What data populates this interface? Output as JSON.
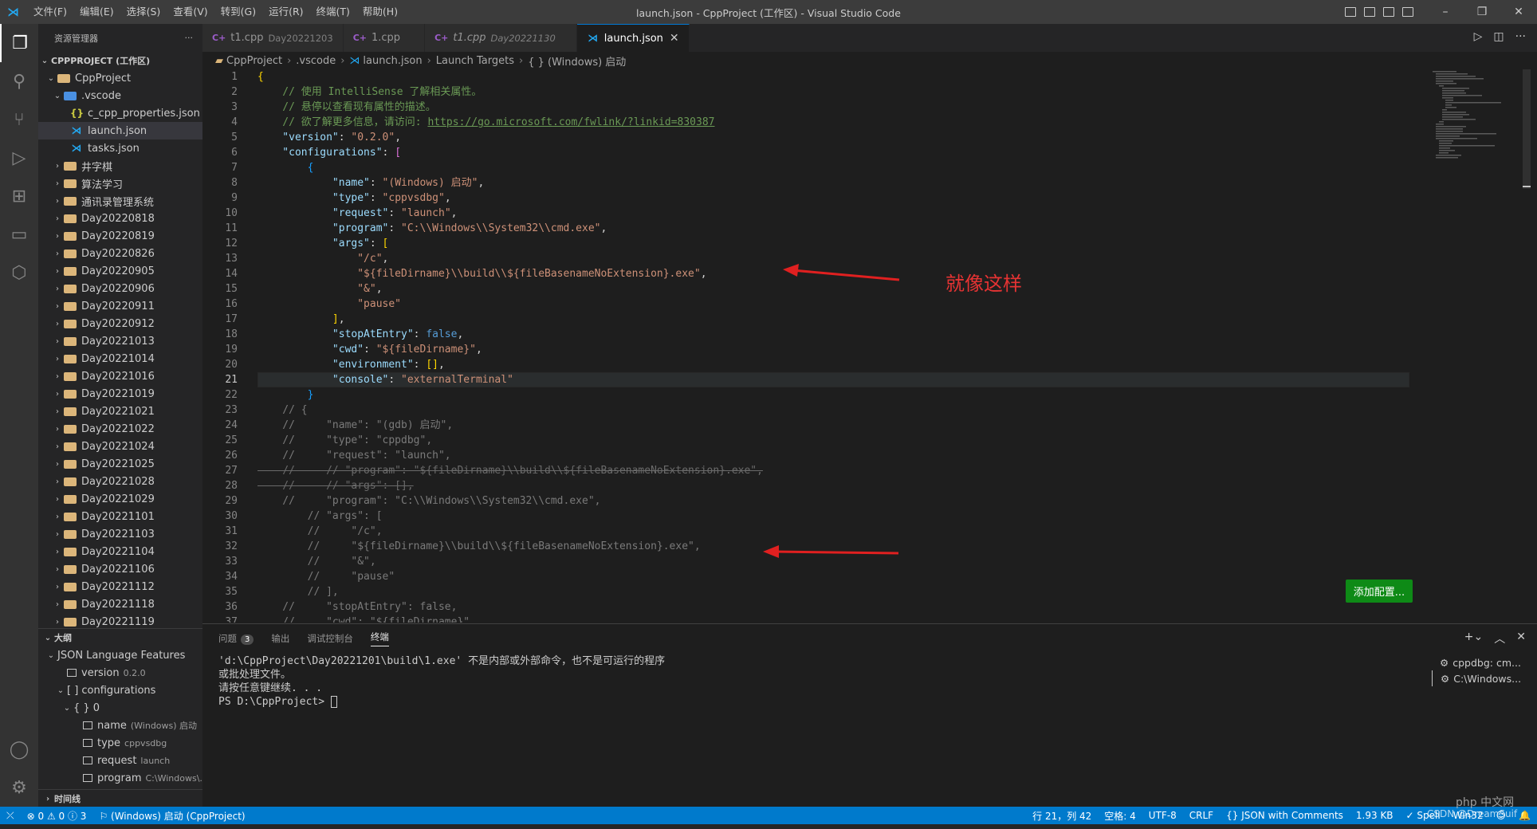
{
  "window_title": "launch.json - CppProject (工作区) - Visual Studio Code",
  "menu": [
    "文件(F)",
    "编辑(E)",
    "选择(S)",
    "查看(V)",
    "转到(G)",
    "运行(R)",
    "终端(T)",
    "帮助(H)"
  ],
  "sidebar": {
    "title": "资源管理器",
    "workspace": "CPPPROJECT (工作区)",
    "project": "CppProject",
    "vscode": ".vscode",
    "vscode_files": [
      "c_cpp_properties.json",
      "launch.json",
      "tasks.json"
    ],
    "folders": [
      "井字棋",
      "算法学习",
      "通讯录管理系统",
      "Day20220818",
      "Day20220819",
      "Day20220826",
      "Day20220905",
      "Day20220906",
      "Day20220911",
      "Day20220912",
      "Day20221013",
      "Day20221014",
      "Day20221016",
      "Day20221019",
      "Day20221021",
      "Day20221022",
      "Day20221024",
      "Day20221025",
      "Day20221028",
      "Day20221029",
      "Day20221101",
      "Day20221103",
      "Day20221104",
      "Day20221106",
      "Day20221112",
      "Day20221118",
      "Day20221119"
    ],
    "outline_title": "大纲",
    "outline": {
      "root": "JSON Language Features",
      "version_label": "version",
      "version_val": "0.2.0",
      "configs": "[ ] configurations",
      "obj": "{ } 0",
      "name_label": "name",
      "name_val": "(Windows) 启动",
      "type_label": "type",
      "type_val": "cppvsdbg",
      "request_label": "request",
      "request_val": "launch",
      "program_label": "program",
      "program_val": "C:\\Windows\\..."
    },
    "timeline": "时间线"
  },
  "tabs": [
    {
      "name": "t1.cpp",
      "sub": "Day20221203"
    },
    {
      "name": "1.cpp",
      "sub": ""
    },
    {
      "name": "t1.cpp",
      "sub": "Day20221130"
    },
    {
      "name": "launch.json",
      "sub": ""
    }
  ],
  "breadcrumb": [
    "CppProject",
    ".vscode",
    "launch.json",
    "Launch Targets",
    "{ } (Windows) 启动"
  ],
  "editor": {
    "current_line": 21
  },
  "annotation": "就像这样",
  "add_config_button": "添加配置...",
  "panel": {
    "tabs": [
      "问题",
      "输出",
      "调试控制台",
      "终端"
    ],
    "problems_count": "3",
    "terminal_lines": [
      "'d:\\CppProject\\Day20221201\\build\\1.exe' 不是内部或外部命令，也不是可运行的程序",
      "或批处理文件。",
      "请按任意键继续. . .",
      "PS D:\\CppProject> "
    ],
    "terminal_list": [
      "cppdbg: cm...",
      "C:\\Windows..."
    ]
  },
  "status": {
    "errors": "0",
    "warnings": "0",
    "info": "3",
    "debug": "(Windows) 启动 (CppProject)",
    "position": "行 21，列 42",
    "spaces": "空格: 4",
    "encoding": "UTF-8",
    "eol": "CRLF",
    "language": "JSON with Comments",
    "size": "1.93 KB",
    "spell": "Spell",
    "platform": "Win32"
  },
  "watermark": "php 中文网",
  "watermark2": "CSDN @DreamSuif"
}
